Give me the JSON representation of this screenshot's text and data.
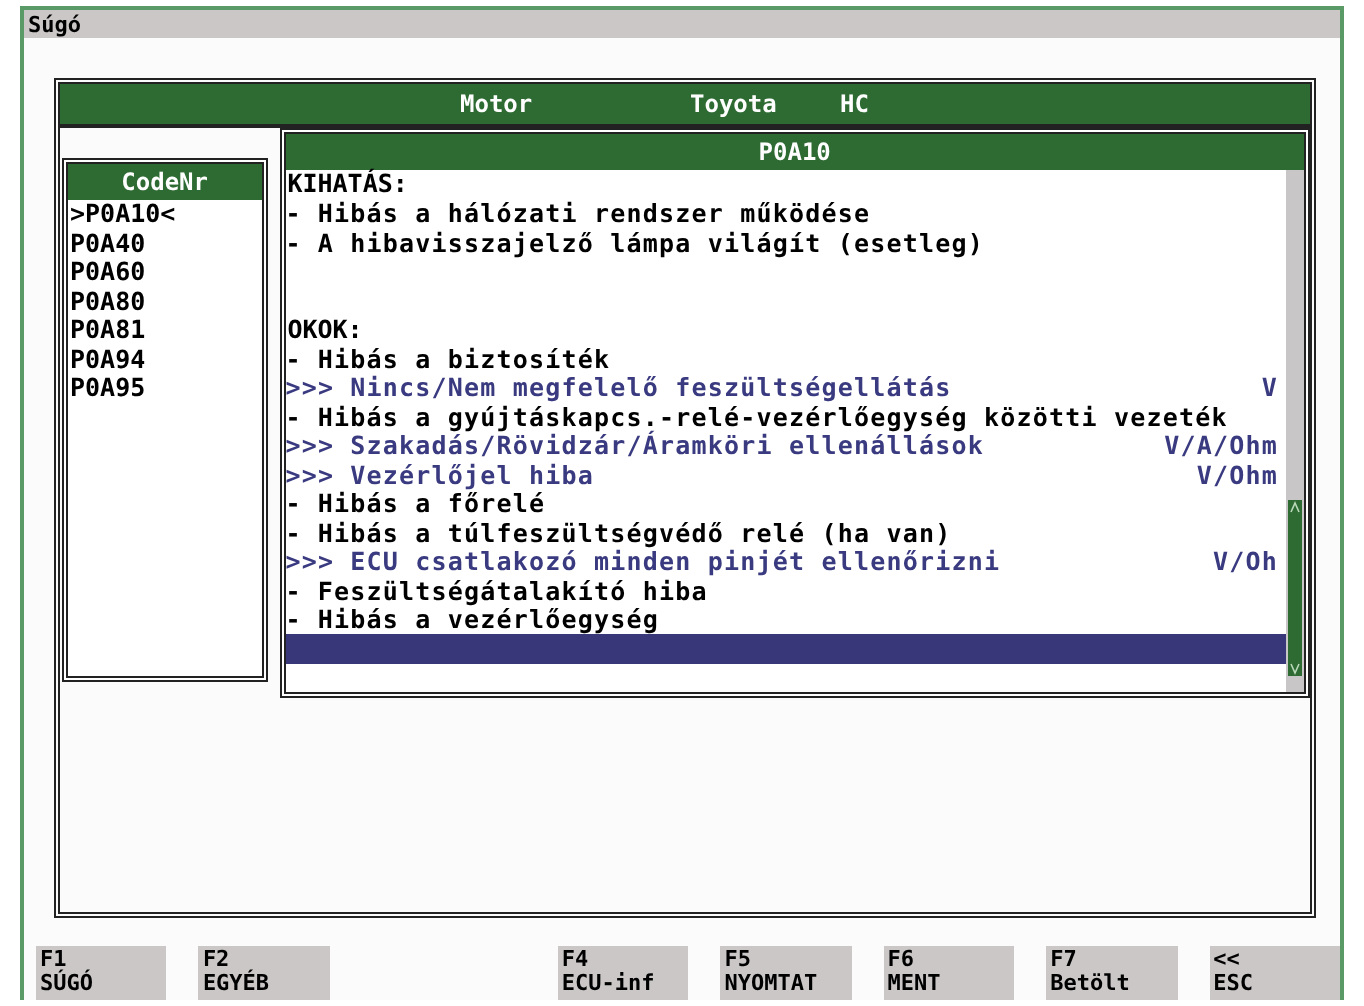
{
  "window": {
    "title": "Súgó"
  },
  "header": [
    "Motor",
    "Toyota",
    "HC"
  ],
  "code_list": {
    "title": "CodeNr",
    "items": [
      {
        "label": ">P0A10<"
      },
      {
        "label": "P0A40"
      },
      {
        "label": "P0A60"
      },
      {
        "label": "P0A80"
      },
      {
        "label": "P0A81"
      },
      {
        "label": "P0A94"
      },
      {
        "label": "P0A95"
      }
    ]
  },
  "detail": {
    "title": "P0A10",
    "sections": [
      {
        "heading": "KIHATÁS:",
        "lines": [
          {
            "kind": "item",
            "marker": "-",
            "text": "Hibás a hálózati rendszer működése"
          },
          {
            "kind": "item",
            "marker": "-",
            "text": "A hibavisszajelző lámpa világít (esetleg)"
          }
        ]
      },
      {
        "heading": "OKOK:",
        "lines": [
          {
            "kind": "item",
            "marker": "-",
            "text": "Hibás a biztosíték"
          },
          {
            "kind": "check",
            "marker": ">>>",
            "text": "Nincs/Nem megfelelő feszültségellátás",
            "unit": "V"
          },
          {
            "kind": "item",
            "marker": "-",
            "text": "Hibás a gyújtáskapcs.-relé-vezérlőegység közötti vezeték"
          },
          {
            "kind": "check",
            "marker": ">>>",
            "text": "Szakadás/Rövidzár/Áramköri ellenállások",
            "unit": "V/A/Ohm"
          },
          {
            "kind": "check",
            "marker": ">>>",
            "text": "Vezérlőjel hiba",
            "unit": "V/Ohm"
          },
          {
            "kind": "item",
            "marker": "-",
            "text": "Hibás a főrelé"
          },
          {
            "kind": "item",
            "marker": "-",
            "text": "Hibás a túlfeszültségvédő relé (ha van)"
          },
          {
            "kind": "check",
            "marker": ">>>",
            "text": "ECU csatlakozó minden pinjét ellenőrizni",
            "unit": "V/Oh"
          },
          {
            "kind": "item",
            "marker": "-",
            "text": "Feszültségátalakító hiba"
          },
          {
            "kind": "item",
            "marker": "-",
            "text": "Hibás a vezérlőegység"
          },
          {
            "kind": "blank",
            "selected": true
          }
        ]
      }
    ]
  },
  "function_keys": [
    {
      "key": "F1",
      "label": "SÚGÓ"
    },
    {
      "key": "F2",
      "label": "EGYÉB"
    },
    {
      "key": "F4",
      "label": "ECU-inf"
    },
    {
      "key": "F5",
      "label": "NYOMTAT"
    },
    {
      "key": "F6",
      "label": "MENT"
    },
    {
      "key": "F7",
      "label": "Betölt"
    },
    {
      "key": "<<",
      "label": "ESC"
    }
  ]
}
